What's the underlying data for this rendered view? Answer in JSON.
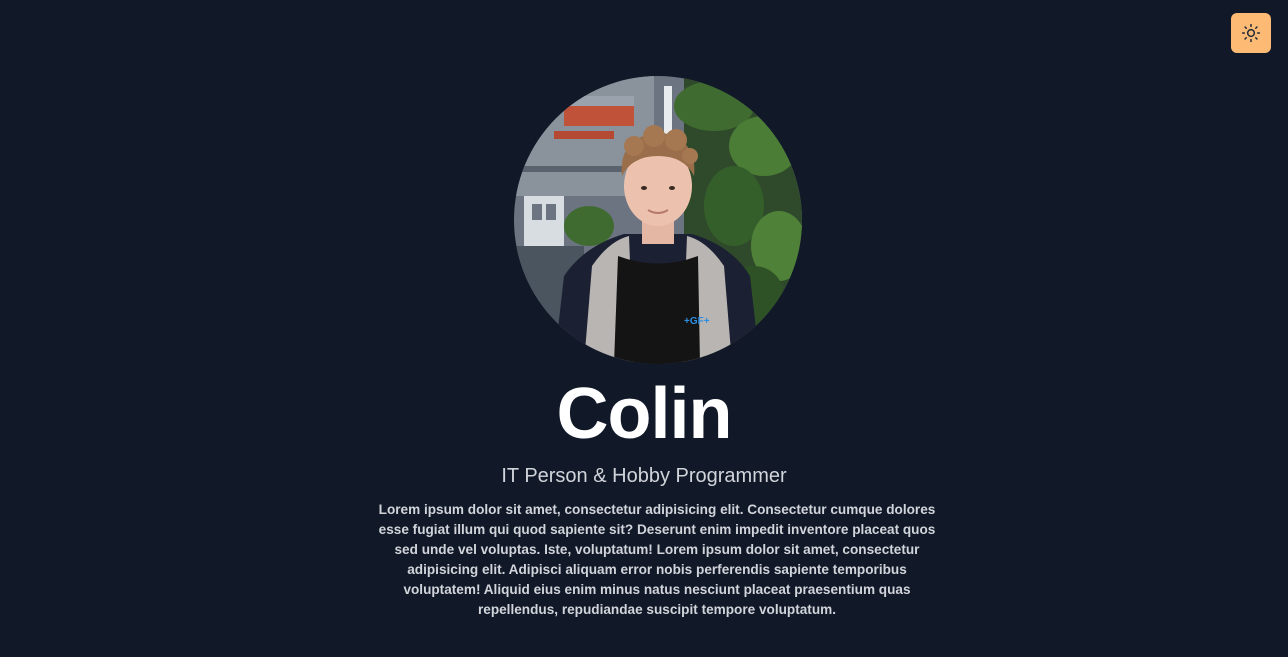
{
  "header": {
    "theme_toggle_icon": "sun-icon",
    "theme_toggle_color": "#fdba74"
  },
  "profile": {
    "avatar_icon": "profile-photo",
    "name": "Colin",
    "tagline": "IT Person & Hobby Programmer",
    "bio": "Lorem ipsum dolor sit amet, consectetur adipisicing elit. Consectetur cumque dolores esse fugiat illum qui quod sapiente sit? Deserunt enim impedit inventore placeat quos sed unde vel voluptas. Iste, voluptatum! Lorem ipsum dolor sit amet, consectetur adipisicing elit. Adipisci aliquam error nobis perferendis sapiente temporibus voluptatem! Aliquid eius enim minus natus nesciunt placeat praesentium quas repellendus, repudiandae suscipit tempore voluptatum.",
    "shirt_logo": "+GF+"
  },
  "colors": {
    "background": "#111827",
    "heading": "#ffffff",
    "text": "#d1d5db"
  }
}
